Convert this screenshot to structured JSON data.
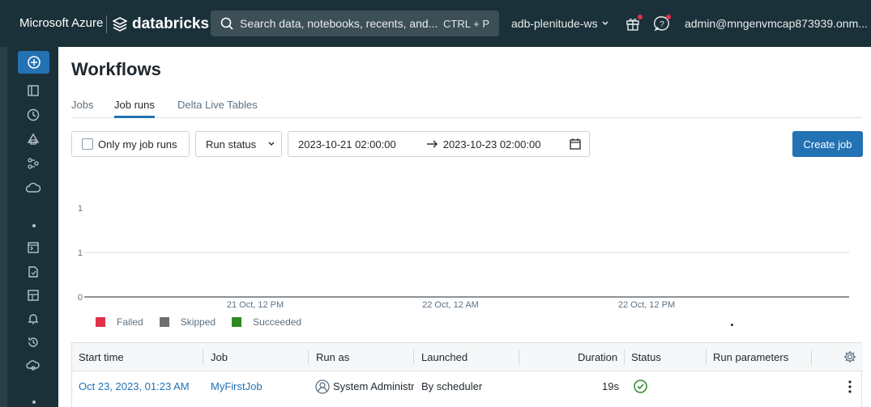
{
  "header": {
    "brand": "Microsoft Azure",
    "product": "databricks",
    "search_placeholder": "Search data, notebooks, recents, and...",
    "search_shortcut": "CTRL + P",
    "workspace": "adb-plenitude-ws",
    "user": "admin@mngenvmcap873939.onm..."
  },
  "page": {
    "title": "Workflows",
    "tabs": [
      {
        "label": "Jobs",
        "active": false
      },
      {
        "label": "Job runs",
        "active": true
      },
      {
        "label": "Delta Live Tables",
        "active": false
      }
    ]
  },
  "filters": {
    "only_my_runs": "Only my job runs",
    "run_status": "Run status",
    "date_from": "2023-10-21 02:00:00",
    "date_to": "2023-10-23 02:00:00",
    "create_job": "Create job"
  },
  "chart_data": {
    "type": "bar",
    "y_ticks": [
      "1",
      "1",
      "0"
    ],
    "x_ticks": [
      "21 Oct, 12 PM",
      "22 Oct, 12 AM",
      "22 Oct, 12 PM"
    ],
    "series": [
      {
        "name": "Failed",
        "color": "#e0314b",
        "values": []
      },
      {
        "name": "Skipped",
        "color": "#6f6f6f",
        "values": []
      },
      {
        "name": "Succeeded",
        "color": "#2e8b24",
        "values": []
      }
    ]
  },
  "table": {
    "columns": [
      "Start time",
      "Job",
      "Run as",
      "Launched",
      "Duration",
      "Status",
      "Run parameters"
    ],
    "rows": [
      {
        "start_time": "Oct 23, 2023, 01:23 AM",
        "job": "MyFirstJob",
        "run_as": "System Administr",
        "launched": "By scheduler",
        "duration": "19s",
        "status": "succeeded"
      }
    ]
  },
  "colors": {
    "header_bg": "#1b3139",
    "accent": "#2272b4",
    "success": "#2e8b24"
  }
}
